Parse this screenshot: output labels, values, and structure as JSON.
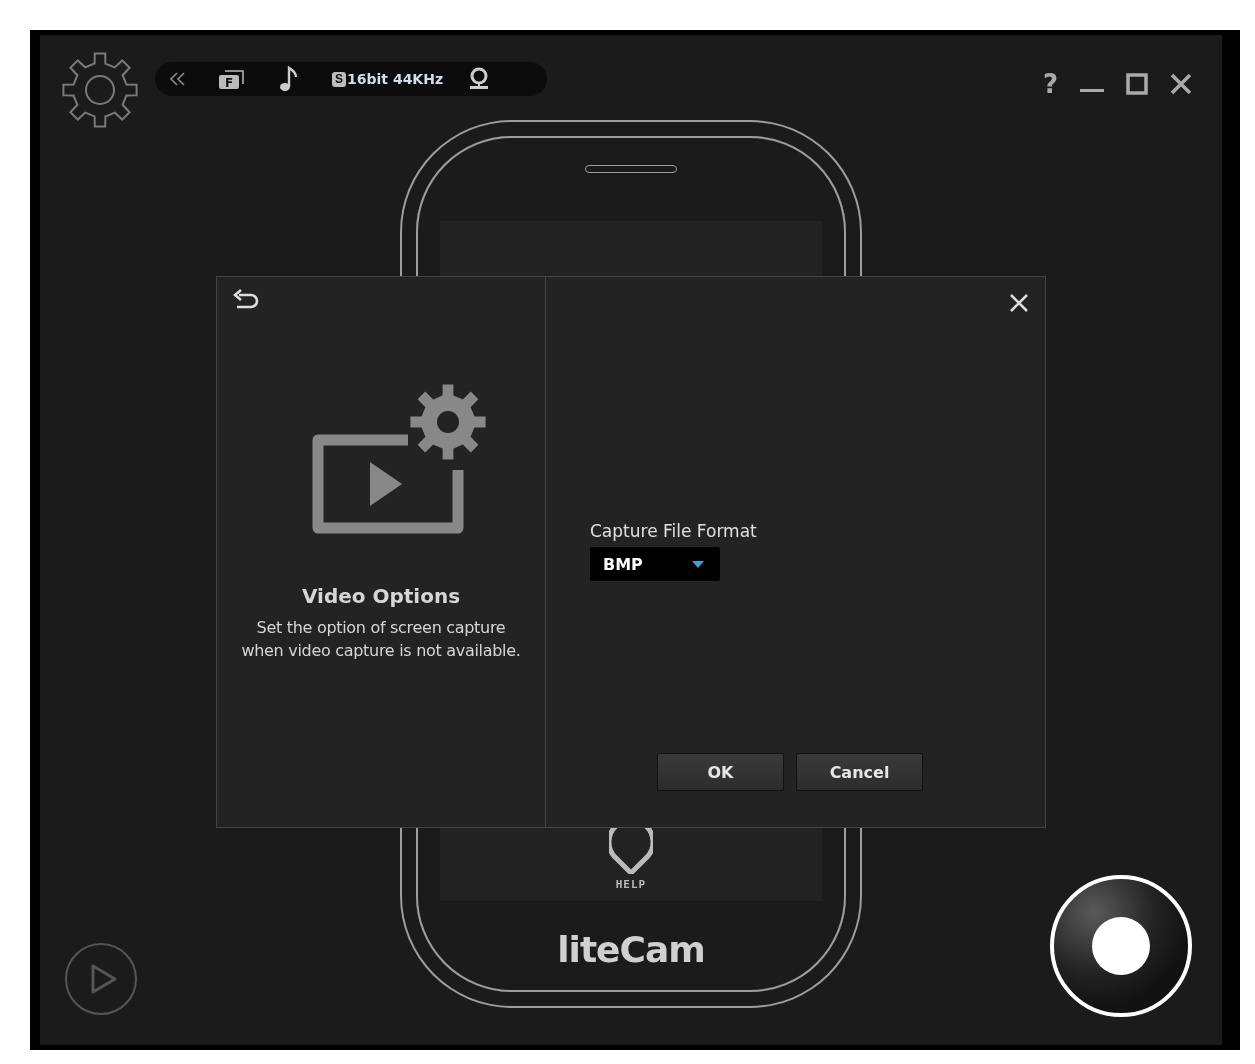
{
  "toolbar": {
    "format_badge": "F",
    "sound_badge": "S",
    "audio_format": "16bit 44KHz"
  },
  "window_controls": {
    "help": "?"
  },
  "phone": {
    "help_label": "HELP",
    "logo": "liteCam"
  },
  "dialog": {
    "title": "Video Options",
    "description": "Set the option of screen capture when video capture is not available.",
    "field_label": "Capture File Format",
    "format": {
      "value": "BMP"
    },
    "buttons": [
      {
        "label": "OK"
      },
      {
        "label": "Cancel"
      }
    ]
  }
}
